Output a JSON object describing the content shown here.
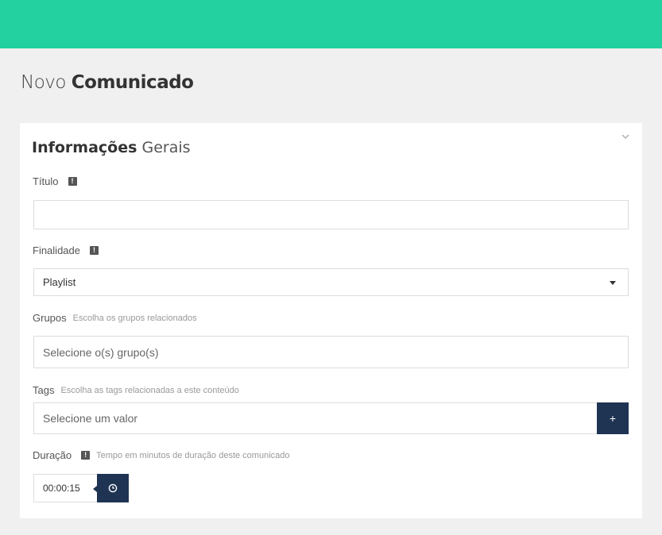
{
  "header": {
    "title_light": "Novo",
    "title_bold": "Comunicado"
  },
  "card": {
    "title_bold": "Informações",
    "title_light": "Gerais",
    "collapse_icon": "chevron-down-icon"
  },
  "fields": {
    "titulo": {
      "label": "Título",
      "badge": "!",
      "value": ""
    },
    "finalidade": {
      "label": "Finalidade",
      "badge": "!",
      "value": "Playlist"
    },
    "grupos": {
      "label": "Grupos",
      "hint": "Escolha os grupos relacionados",
      "placeholder": "Selecione o(s) grupo(s)"
    },
    "tags": {
      "label": "Tags",
      "hint": "Escolha as tags relacionadas a este conteúdo",
      "placeholder": "Selecione um valor",
      "add_label": "+"
    },
    "duracao": {
      "label": "Duração",
      "badge": "!",
      "hint": "Tempo em minutos de duração deste comunicado",
      "value": "00:00:15"
    }
  },
  "colors": {
    "topbar": "#22d0a0",
    "accent_button": "#1f3352",
    "page_bg": "#f0f0f0"
  }
}
